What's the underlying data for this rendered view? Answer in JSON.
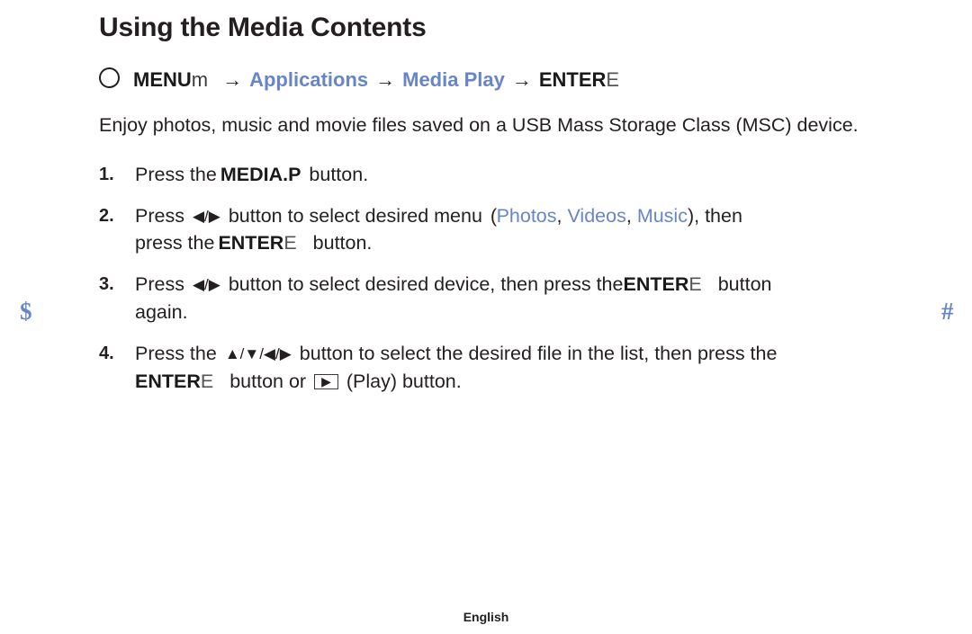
{
  "document": {
    "title": "Using the Media Contents",
    "footer_label": "English"
  },
  "margin_marks": {
    "left": "$",
    "right": "#"
  },
  "menu_path": {
    "bullet_icon": "circle-outline-icon",
    "key_label": "MENU",
    "key_suffix": "m",
    "arrow": "→",
    "step1": "Applications",
    "step2": "Media Play",
    "enter_label": "ENTER",
    "enter_suffix": "E"
  },
  "intro": "Enjoy photos, music and movie files saved on a USB Mass Storage Class (MSC) device.",
  "steps": [
    {
      "number": "1.",
      "pre": "Press the",
      "key": "MEDIA.P",
      "post": "button."
    },
    {
      "number": "2.",
      "pre": "Press",
      "dirs": "◀/▶",
      "mid": "button to select desired menu",
      "paren_open": "(",
      "option1": "Photos",
      "comma1": ",",
      "option2": "Videos",
      "comma2": ",",
      "option3": "Music",
      "paren_close": ")",
      "tail": ", then",
      "line2_pre": "press the",
      "enter_label": "ENTER",
      "enter_suffix": "E",
      "line2_post": "button."
    },
    {
      "number": "3.",
      "pre": "Press",
      "dirs": "◀/▶",
      "mid": "button to select desired device, then press the",
      "enter_label": "ENTER",
      "enter_suffix": "E",
      "post": "button",
      "line2": "again."
    },
    {
      "number": "4.",
      "pre": "Press the",
      "dirs": "▲/▼/◀/▶",
      "mid": "button to select the desired file in the list, then press the",
      "enter_label": "ENTER",
      "enter_suffix": "E",
      "line2_mid": "button or",
      "play_icon": "play-button-icon",
      "play_glyph": "▶",
      "line2_post": "(Play) button."
    }
  ],
  "colors": {
    "accent_blue": "#6785c8",
    "text": "#231f20"
  }
}
